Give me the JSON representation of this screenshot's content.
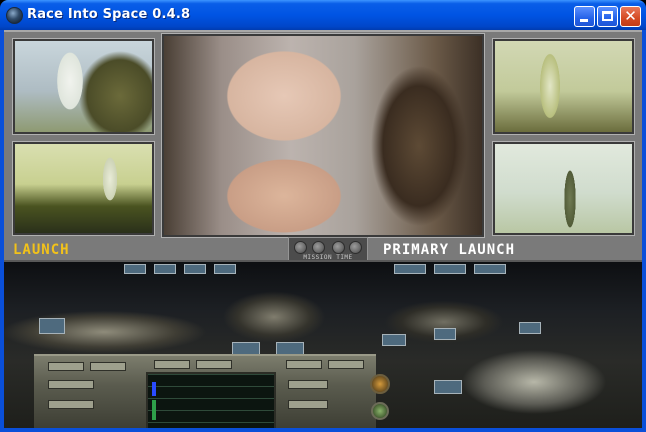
{
  "window": {
    "title": "Race Into Space 0.4.8",
    "buttons": {
      "minimize": "minimize",
      "maximize": "maximize",
      "close": "✕"
    }
  },
  "screen": {
    "left_label": "LAUNCH",
    "right_label": "PRIMARY LAUNCH",
    "mission_time_label": "MISSION TIME"
  },
  "icons": {
    "app": "race-into-space-icon",
    "minimize": "minimize-icon",
    "maximize": "maximize-icon",
    "close": "close-icon"
  },
  "colors": {
    "titlebar": "#0054e3",
    "close_button": "#d44a22",
    "left_label": "#f2c21a",
    "right_label": "#ffffff",
    "panel": "#7a7a7a"
  }
}
